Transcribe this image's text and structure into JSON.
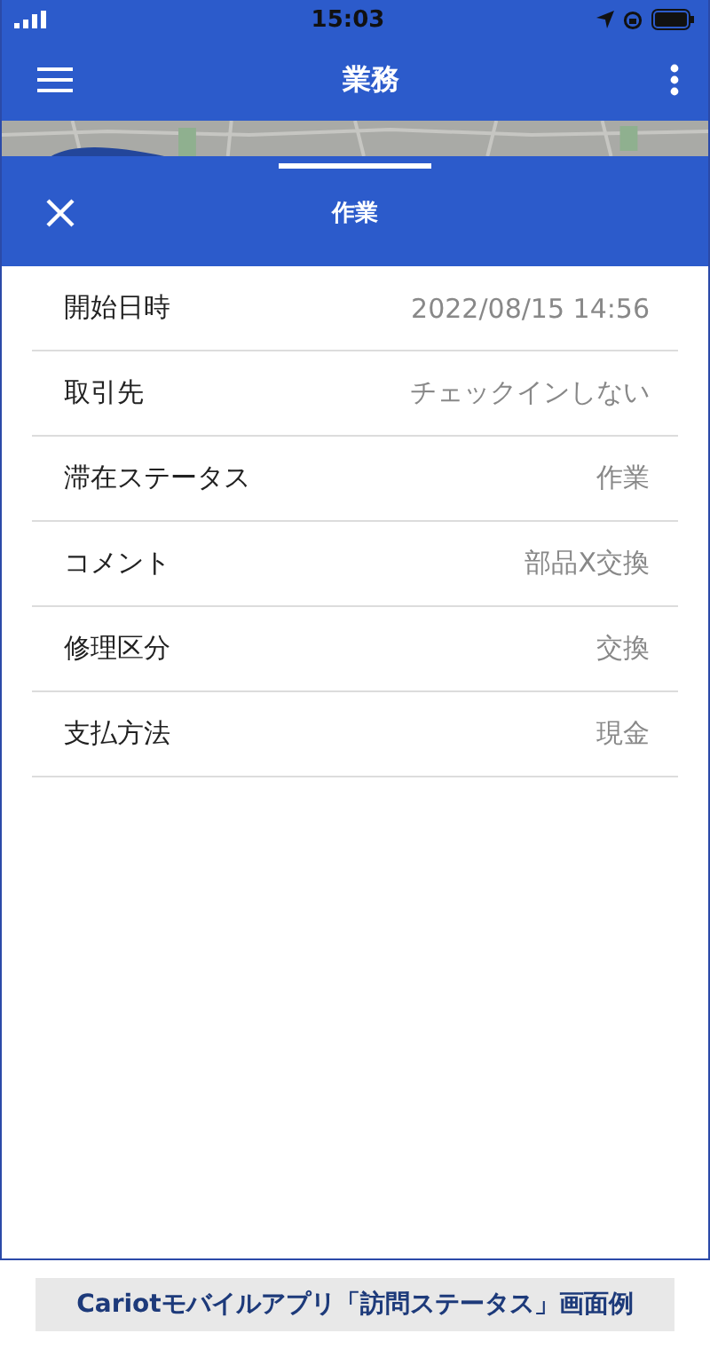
{
  "status_bar": {
    "time": "15:03"
  },
  "app_bar": {
    "title": "業務"
  },
  "sheet": {
    "title": "作業"
  },
  "rows": [
    {
      "label": "開始日時",
      "value": "2022/08/15 14:56"
    },
    {
      "label": "取引先",
      "value": "チェックインしない"
    },
    {
      "label": "滞在ステータス",
      "value": "作業"
    },
    {
      "label": "コメント",
      "value": "部品X交換"
    },
    {
      "label": "修理区分",
      "value": "交換"
    },
    {
      "label": "支払方法",
      "value": "現金"
    }
  ],
  "caption": "Cariotモバイルアプリ「訪問ステータス」画面例"
}
